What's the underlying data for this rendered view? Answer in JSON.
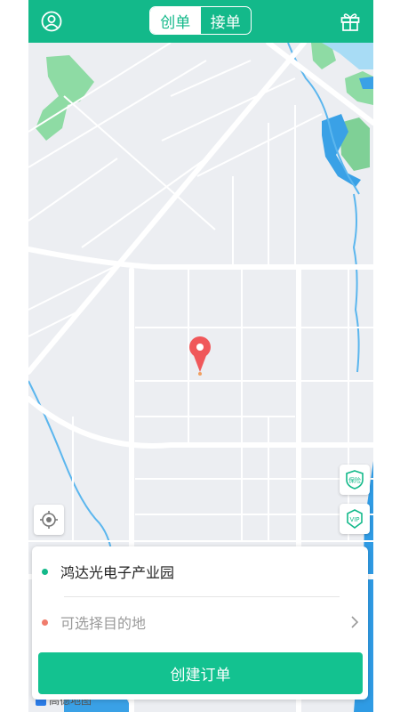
{
  "header": {
    "tabs": [
      {
        "label": "创单",
        "active": true
      },
      {
        "label": "接单",
        "active": false
      }
    ],
    "brand_color": "#13b98a",
    "left_icon": "user-profile-icon",
    "right_icon": "gift-icon"
  },
  "map": {
    "side_buttons": [
      {
        "icon": "insurance-shield-icon",
        "label": "保险"
      },
      {
        "icon": "vip-badge-icon",
        "label": "VIP"
      }
    ],
    "locate_icon": "locate-icon",
    "pin_color": "#f0575a",
    "logo_text": "高德地图"
  },
  "order": {
    "origin": "鸿达光电子产业园",
    "origin_dot_color": "#13b98a",
    "destination_placeholder": "可选择目的地",
    "destination_dot_color": "#f07c6c",
    "submit_label": "创建订单"
  }
}
